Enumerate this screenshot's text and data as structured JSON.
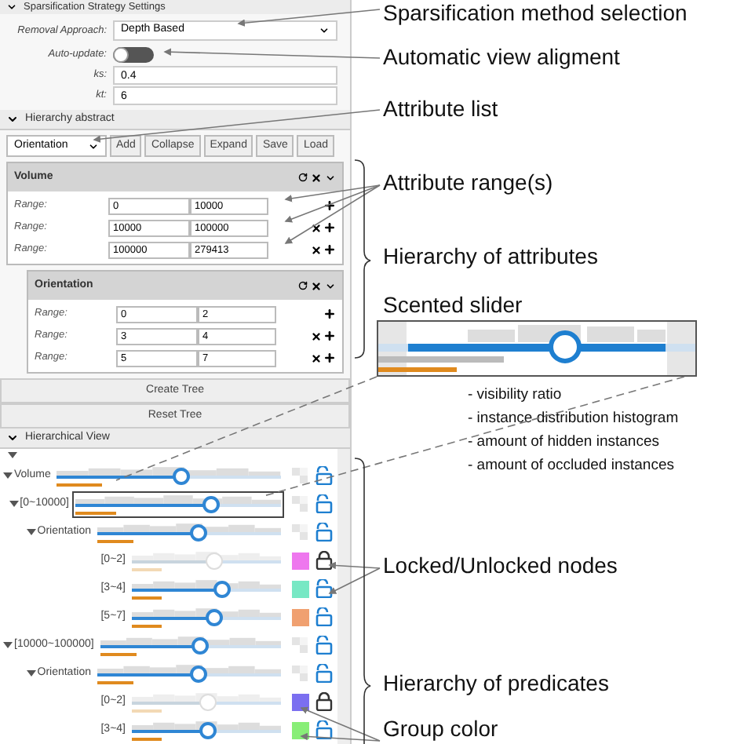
{
  "panel_title": "Sparsification Strategy Settings",
  "removal_approach": {
    "label": "Removal Approach:",
    "value": "Depth Based"
  },
  "auto_update": {
    "label": "Auto-update:",
    "on": false
  },
  "params": [
    {
      "label": "ks:",
      "value": "0.4"
    },
    {
      "label": "kt:",
      "value": "6"
    }
  ],
  "hierarchy_abstract": {
    "title": "Hierarchy abstract",
    "attribute_select": "Orientation",
    "buttons": [
      "Add",
      "Collapse",
      "Expand",
      "Save",
      "Load"
    ],
    "attributes": [
      {
        "name": "Volume",
        "ranges": [
          {
            "label": "Range:",
            "min": "0",
            "max": "10000",
            "removable": false
          },
          {
            "label": "Range:",
            "min": "10000",
            "max": "100000",
            "removable": true
          },
          {
            "label": "Range:",
            "min": "100000",
            "max": "279413",
            "removable": true
          }
        ],
        "children": [
          {
            "name": "Orientation",
            "ranges": [
              {
                "label": "Range:",
                "min": "0",
                "max": "2",
                "removable": false
              },
              {
                "label": "Range:",
                "min": "3",
                "max": "4",
                "removable": true
              },
              {
                "label": "Range:",
                "min": "5",
                "max": "7",
                "removable": true
              }
            ]
          }
        ]
      }
    ]
  },
  "tree_buttons": [
    "Create Tree",
    "Reset Tree"
  ],
  "hierarchical_view": {
    "title": "Hierarchical View",
    "root_expanded": true,
    "nodes": [
      {
        "label": "Volume",
        "level": 0.55,
        "locked": false,
        "expanded": true,
        "children": [
          {
            "label": "[0~10000]",
            "level": 0.66,
            "locked": false,
            "selected": true,
            "expanded": true,
            "children": [
              {
                "label": "Orientation",
                "level": 0.55,
                "locked": false,
                "expanded": true,
                "children": [
                  {
                    "label": "[0~2]",
                    "level": 0.55,
                    "locked": true,
                    "color": "#ee77ee"
                  },
                  {
                    "label": "[3~4]",
                    "level": 0.6,
                    "locked": false,
                    "color": "#77e8c4"
                  },
                  {
                    "label": "[5~7]",
                    "level": 0.55,
                    "locked": false,
                    "color": "#f0a070"
                  }
                ]
              }
            ]
          },
          {
            "label": "[10000~100000]",
            "level": 0.55,
            "locked": false,
            "selected": false,
            "expanded": true,
            "children": [
              {
                "label": "Orientation",
                "level": 0.55,
                "locked": false,
                "expanded": true,
                "children": [
                  {
                    "label": "[0~2]",
                    "level": 0.5,
                    "locked": true,
                    "color": "#7b6ff0"
                  },
                  {
                    "label": "[3~4]",
                    "level": 0.5,
                    "locked": false,
                    "color": "#88ee77"
                  }
                ]
              }
            ]
          }
        ]
      }
    ]
  },
  "annotations": [
    "Sparsification method selection",
    "Automatic view aligment",
    "Attribute list",
    "Attribute range(s)",
    "Hierarchy of attributes",
    "Scented slider",
    "Locked/Unlocked nodes",
    "Hierarchy of predicates",
    "Group color"
  ],
  "slider_legend": [
    "- visibility ratio",
    "- instance distribution histogram",
    "- amount of hidden instances",
    "- amount of occluded instances"
  ]
}
